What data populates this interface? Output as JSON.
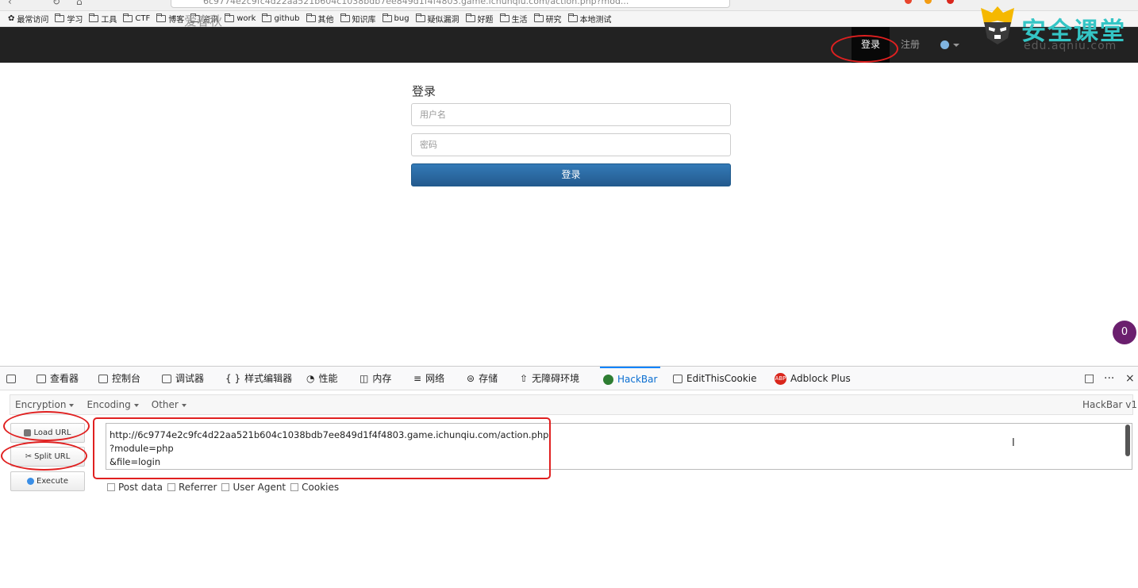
{
  "browser": {
    "url_partial": "6c9774e2c9fc4d22aa521b604c1038bdb7ee849d1f4f4803.game.ichunqiu.com/action.php?mod...",
    "bookmarks": [
      "最常访问",
      "学习",
      "工具",
      "CTF",
      "博客",
      "资讯",
      "work",
      "github",
      "其他",
      "知识库",
      "bug",
      "疑似漏洞",
      "好题",
      "生活",
      "研究",
      "本地测试"
    ]
  },
  "watermark": {
    "title": "安全课堂",
    "subtitle": "edu.aqniu.com"
  },
  "site": {
    "brand": "爱春秋",
    "nav": {
      "login": "登录",
      "register": "注册"
    },
    "form": {
      "title": "登录",
      "username_placeholder": "用户名",
      "password_placeholder": "密码",
      "submit": "登录"
    },
    "badge": "0"
  },
  "devtools": {
    "tabs": [
      "查看器",
      "控制台",
      "调试器",
      "样式编辑器",
      "性能",
      "内存",
      "网络",
      "存储",
      "无障碍环境",
      "HackBar",
      "EditThisCookie",
      "Adblock Plus"
    ],
    "active_tab": "HackBar",
    "right_icons": [
      "□",
      "···",
      "×"
    ]
  },
  "hackbar": {
    "menu": [
      "Encryption",
      "Encoding",
      "Other"
    ],
    "version": "HackBar v1",
    "buttons": {
      "load": "Load URL",
      "split": "Split URL",
      "execute": "Execute"
    },
    "url_lines": [
      "http://6c9774e2c9fc4d22aa521b604c1038bdb7ee849d1f4f4803.game.ichunqiu.com/action.php",
      "?module=php",
      "&file=login"
    ],
    "checkboxes": [
      "Post data",
      "Referrer",
      "User Agent",
      "Cookies"
    ]
  },
  "colors": {
    "navbar": "#222222",
    "primary": "#337ab7",
    "annotation": "#e02020",
    "watermark": "#34c5c5",
    "badge": "#6b1f6e"
  }
}
